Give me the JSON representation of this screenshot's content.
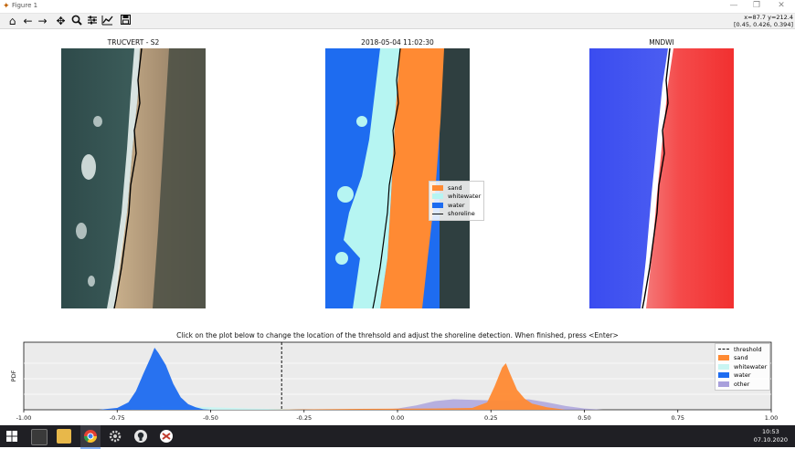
{
  "window": {
    "title": "Figure 1",
    "app_icon": "matplotlib-icon"
  },
  "window_controls": [
    "minimize-icon",
    "maximize-icon",
    "close-icon"
  ],
  "toolbar": {
    "buttons": [
      "home-icon",
      "back-arrow-icon",
      "forward-arrow-icon",
      "pan-icon",
      "zoom-icon",
      "subplots-config-icon",
      "edit-axis-icon",
      "save-icon"
    ],
    "coords_line1": "x=87.7 y=212.4",
    "coords_line2": "[0.45, 0.426, 0.394]"
  },
  "panels": {
    "left_title": "TRUCVERT - S2",
    "middle_title": "2018-05-04  11:02:30",
    "right_title": "MNDWI"
  },
  "classification_legend": [
    {
      "label": "sand",
      "color": "#ff8a33"
    },
    {
      "label": "whitewater",
      "color": "#b6f5f2"
    },
    {
      "label": "water",
      "color": "#1e6cf0"
    },
    {
      "label": "shoreline",
      "color": "#111111"
    }
  ],
  "histogram": {
    "caption": "Click on the plot below to change the location of the threhsold and adjust the shoreline detection. When finished, press <Enter>",
    "ylabel": "PDF",
    "threshold": -0.31,
    "legend": [
      {
        "label": "threshold",
        "kind": "dash",
        "color": "#111111"
      },
      {
        "label": "sand",
        "kind": "patch",
        "color": "#ff8a33"
      },
      {
        "label": "whitewater",
        "kind": "patch",
        "color": "#c8f5f2"
      },
      {
        "label": "water",
        "kind": "patch",
        "color": "#1e6cf0"
      },
      {
        "label": "other",
        "kind": "patch",
        "color": "#a9a0dc"
      }
    ]
  },
  "chart_data": {
    "type": "area",
    "xlim": [
      -1.0,
      1.0
    ],
    "x_ticks": [
      "-1.00",
      "-0.75",
      "-0.50",
      "-0.25",
      "0.00",
      "0.25",
      "0.50",
      "0.75",
      "1.00"
    ],
    "grid": true,
    "legend_position": "top-right",
    "series": [
      {
        "name": "water",
        "color": "#1e6cf0",
        "x": [
          -0.8,
          -0.75,
          -0.72,
          -0.7,
          -0.68,
          -0.66,
          -0.65,
          -0.64,
          -0.62,
          -0.6,
          -0.58,
          -0.56,
          -0.54,
          -0.52,
          -0.5
        ],
        "y": [
          0.0,
          0.03,
          0.12,
          0.3,
          0.58,
          0.85,
          1.0,
          0.92,
          0.72,
          0.42,
          0.2,
          0.09,
          0.04,
          0.01,
          0.0
        ]
      },
      {
        "name": "whitewater",
        "color": "#c8f5f2",
        "x": [
          -0.72,
          -0.65,
          -0.6,
          -0.55,
          -0.5,
          -0.45,
          -0.4,
          -0.35,
          -0.3,
          -0.25
        ],
        "y": [
          0.0,
          0.05,
          0.06,
          0.05,
          0.04,
          0.03,
          0.02,
          0.015,
          0.01,
          0.0
        ]
      },
      {
        "name": "sand",
        "color": "#ff8a33",
        "x": [
          -0.35,
          -0.1,
          0.1,
          0.2,
          0.24,
          0.26,
          0.28,
          0.29,
          0.3,
          0.32,
          0.34,
          0.36,
          0.4,
          0.45
        ],
        "y": [
          0.0,
          0.015,
          0.02,
          0.03,
          0.12,
          0.38,
          0.68,
          0.75,
          0.6,
          0.32,
          0.18,
          0.1,
          0.04,
          0.0
        ]
      },
      {
        "name": "other",
        "color": "#a9a0dc",
        "x": [
          -0.05,
          0.0,
          0.05,
          0.1,
          0.15,
          0.2,
          0.25,
          0.3,
          0.35,
          0.4,
          0.45,
          0.5,
          0.55
        ],
        "y": [
          0.0,
          0.02,
          0.07,
          0.14,
          0.17,
          0.16,
          0.15,
          0.15,
          0.17,
          0.12,
          0.06,
          0.02,
          0.0
        ]
      }
    ]
  },
  "taskbar": {
    "apps": [
      "windows-start-icon",
      "terminal-icon",
      "file-explorer-icon",
      "chrome-icon",
      "settings-gear-icon",
      "github-icon",
      "python-app-icon"
    ],
    "time": "10:53",
    "date": "07.10.2020"
  }
}
